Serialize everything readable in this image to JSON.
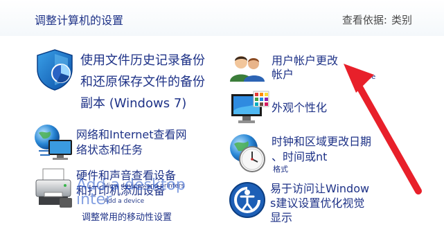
{
  "header": {
    "title": "调整计算机的设置",
    "view_by_label": "查看依据:",
    "view_by_value": "类别"
  },
  "left_column": {
    "system_security": {
      "title_lines": [
        "使用文件历史记录备份",
        "和还原保存文件的备份",
        "副本 (Windows 7)"
      ],
      "icon": "shield-icon"
    },
    "network": {
      "title_lines": [
        "网络和Internet查看网",
        "络状态和任务"
      ],
      "icon": "network-globe-icon"
    },
    "hardware": {
      "title_lines": [
        "硬件和声音查看设备",
        "和打印机添加设备"
      ],
      "sub_ghost_1": "View devices and printers",
      "sub_ghost_2": "Add a device",
      "overlay_lines": [
        "Add a desktop",
        "inter"
      ],
      "bottom_link": "调整常用的移动性设置",
      "icon": "printer-icon"
    }
  },
  "right_column": {
    "user_accounts": {
      "title_lines": [
        "用户帐户更改",
        "帐户"
      ],
      "ghost_text": "type",
      "icon": "users-icon"
    },
    "appearance": {
      "title": "外观个性化",
      "icon": "monitor-palette-icon"
    },
    "clock_region": {
      "title_lines": [
        "时钟和区域更改日期",
        "、时间或nt"
      ],
      "sub": "格式",
      "icon": "clock-globe-icon"
    },
    "ease_of_access": {
      "title_lines": [
        "易于访问让Window",
        "s建议设置优化视觉",
        "显示"
      ],
      "icon": "ease-of-access-icon"
    }
  },
  "annotation": {
    "arrow_color": "#e8202a"
  }
}
